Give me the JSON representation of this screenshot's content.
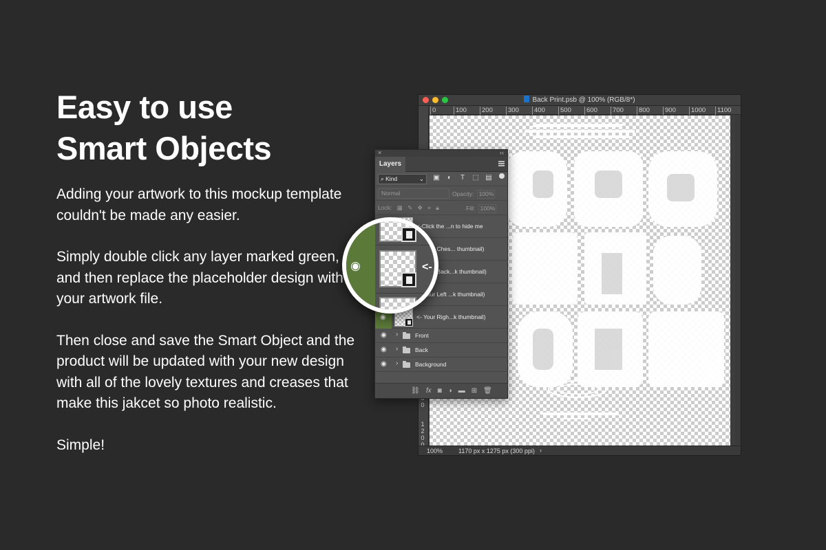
{
  "copy": {
    "headline_line1": "Easy to use",
    "headline_line2": "Smart Objects",
    "paragraphs": [
      "Adding your artwork to this mockup template couldn't be made any easier.",
      "Simply double click any layer marked green, and then replace the placeholder design with your artwork file.",
      "Then close and save the Smart Object and the product will be updated with your new design with all of the lovely textures and creases that make this jakcet so photo realistic.",
      "Simple!"
    ]
  },
  "document": {
    "title": "Back Print.psb @ 100% (RGB/8*)",
    "ruler_h": [
      "0",
      "100",
      "200",
      "300",
      "400",
      "500",
      "600",
      "700",
      "800",
      "900",
      "1000",
      "1100"
    ],
    "ruler_v": [
      "1000",
      "1100",
      "1200"
    ],
    "zoom": "100%",
    "size_info": "1170 px x 1275 px (300 ppi)",
    "status_arrow": "›"
  },
  "layers_panel": {
    "tab": "Layers",
    "close_glyph": "×",
    "collapse_glyph": "‹‹",
    "filter_kind": "Kind",
    "blend_mode": "Normal",
    "opacity_label": "Opacity:",
    "opacity_value": "100%",
    "lock_label": "Lock:",
    "fill_label": "Fill:",
    "fill_value": "100%",
    "smart_layers": [
      {
        "name": "<-Click the ...n to hide me",
        "green": false
      },
      {
        "name": "<- Your Ches... thumbnail)",
        "green": true
      },
      {
        "name": "<- Your Back...k thumbnail)",
        "green": true
      },
      {
        "name": "<- Your Left ...k thumbnail)",
        "green": true
      },
      {
        "name": "<- Your Righ...k thumbnail)",
        "green": true
      }
    ],
    "groups": [
      "Front",
      "Back",
      "Background"
    ]
  },
  "icons": {
    "eye": "eye-icon",
    "folder": "folder-icon",
    "link": "link-icon",
    "fx": "fx-icon",
    "mask": "mask-icon",
    "adjustment": "adjustment-icon",
    "new_group": "new-group-icon",
    "new_layer": "new-layer-icon",
    "trash": "trash-icon"
  },
  "magnifier": {
    "arrow_text": "<-"
  },
  "colors": {
    "background": "#2a2a2a",
    "smart_object_green": "#5b7a3a",
    "panel": "#535353"
  }
}
